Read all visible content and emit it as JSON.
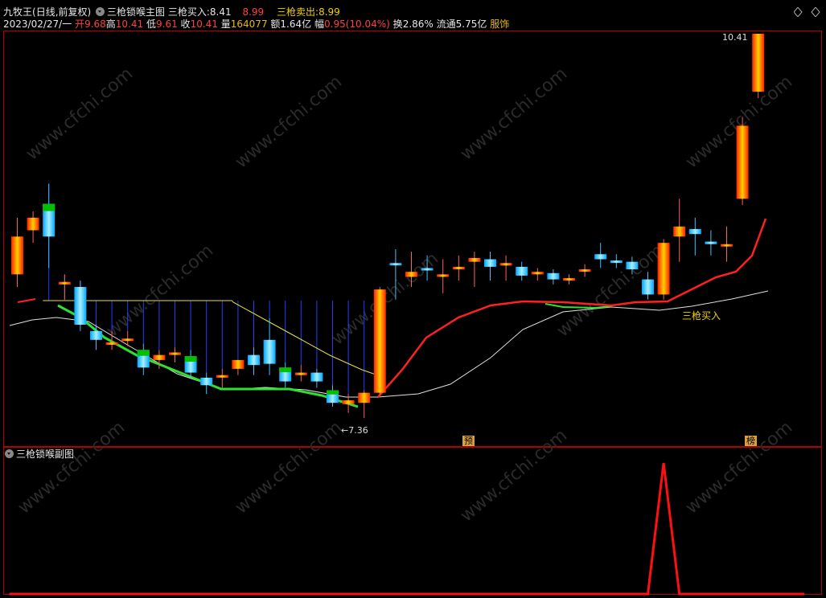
{
  "main_title": {
    "app": "九牧王",
    "period": "(日线,前复权)",
    "indicator": "三枪锁喉主图",
    "buy_label": "三枪买入:",
    "buy_value": "8.41",
    "buy_value2": "8.99",
    "sell_label": "三枪卖出:",
    "sell_value": "8.99"
  },
  "quote": {
    "date": "2023/02/27/一",
    "open_label": "开",
    "open": "9.68",
    "high_label": "高",
    "high": "10.41",
    "low_label": "低",
    "low": "9.61",
    "close_label": "收",
    "close": "10.41",
    "vol_label": "量",
    "vol": "164077",
    "amount_label": "额",
    "amount": "1.64亿",
    "change_label": "幅",
    "change": "0.95(10.04%)",
    "turnover_label": "换",
    "turnover": "2.86%",
    "float_label": "流通",
    "float": "5.75亿",
    "sector": "服饰"
  },
  "annotations": {
    "high_mark": "10.41",
    "low_mark": "←7.36",
    "buy_signal": "三枪买入",
    "tag_yu": "预",
    "tag_bang": "榜"
  },
  "sub_title": "三枪锁喉副图",
  "watermark": "www.cfchi.com",
  "colors": {
    "frame": "#b00000",
    "bull_red": "#ff2000",
    "bull_yellow": "#ffd000",
    "bear_cyan": "#00a8ff",
    "bear_green": "#00c000",
    "ma_green": "#30e030",
    "ma_red": "#ff2020",
    "line_white": "#e0e0e0",
    "line_yellow": "#e8e040",
    "sub_line": "#ff1010"
  },
  "chart_data": {
    "type": "candlestick",
    "price_range": [
      7.36,
      10.41
    ],
    "candles": [
      {
        "o": 8.8,
        "c": 8.5,
        "h": 8.95,
        "l": 8.4,
        "dir": "up"
      },
      {
        "o": 8.85,
        "c": 8.95,
        "h": 9.0,
        "l": 8.75,
        "dir": "up"
      },
      {
        "o": 8.8,
        "c": 9.06,
        "h": 9.22,
        "l": 8.55,
        "dir": "down"
      },
      {
        "o": 8.42,
        "c": 8.44,
        "h": 8.5,
        "l": 8.3,
        "dir": "up"
      },
      {
        "o": 8.4,
        "c": 8.1,
        "h": 8.45,
        "l": 8.05,
        "dir": "down"
      },
      {
        "o": 8.05,
        "c": 7.98,
        "h": 8.1,
        "l": 7.9,
        "dir": "down"
      },
      {
        "o": 7.95,
        "c": 7.96,
        "h": 8.05,
        "l": 7.9,
        "dir": "up"
      },
      {
        "o": 7.98,
        "c": 7.99,
        "h": 8.05,
        "l": 7.93,
        "dir": "up"
      },
      {
        "o": 7.9,
        "c": 7.76,
        "h": 7.95,
        "l": 7.7,
        "dir": "down"
      },
      {
        "o": 7.82,
        "c": 7.86,
        "h": 7.9,
        "l": 7.75,
        "dir": "up"
      },
      {
        "o": 7.86,
        "c": 7.88,
        "h": 7.92,
        "l": 7.8,
        "dir": "up"
      },
      {
        "o": 7.85,
        "c": 7.72,
        "h": 7.9,
        "l": 7.68,
        "dir": "down"
      },
      {
        "o": 7.68,
        "c": 7.62,
        "h": 7.72,
        "l": 7.55,
        "dir": "down"
      },
      {
        "o": 7.68,
        "c": 7.7,
        "h": 7.75,
        "l": 7.6,
        "dir": "up"
      },
      {
        "o": 7.75,
        "c": 7.82,
        "h": 7.8,
        "l": 7.7,
        "dir": "up"
      },
      {
        "o": 7.78,
        "c": 7.86,
        "h": 7.92,
        "l": 7.7,
        "dir": "down"
      },
      {
        "o": 7.79,
        "c": 7.98,
        "h": 8.15,
        "l": 7.7,
        "dir": "down"
      },
      {
        "o": 7.76,
        "c": 7.65,
        "h": 7.8,
        "l": 7.6,
        "dir": "down"
      },
      {
        "o": 7.72,
        "c": 7.7,
        "h": 7.78,
        "l": 7.65,
        "dir": "up"
      },
      {
        "o": 7.72,
        "c": 7.65,
        "h": 7.75,
        "l": 7.6,
        "dir": "down"
      },
      {
        "o": 7.58,
        "c": 7.48,
        "h": 7.62,
        "l": 7.45,
        "dir": "down"
      },
      {
        "o": 7.5,
        "c": 7.47,
        "h": 7.55,
        "l": 7.4,
        "dir": "up"
      },
      {
        "o": 7.48,
        "c": 7.56,
        "h": 7.58,
        "l": 7.36,
        "dir": "up"
      },
      {
        "o": 7.56,
        "c": 8.38,
        "h": 8.4,
        "l": 7.54,
        "dir": "up"
      },
      {
        "o": 8.59,
        "c": 8.58,
        "h": 8.7,
        "l": 8.3,
        "dir": "down"
      },
      {
        "o": 8.52,
        "c": 8.48,
        "h": 8.68,
        "l": 8.4,
        "dir": "up"
      },
      {
        "o": 8.55,
        "c": 8.54,
        "h": 8.65,
        "l": 8.45,
        "dir": "down"
      },
      {
        "o": 8.5,
        "c": 8.48,
        "h": 8.62,
        "l": 8.35,
        "dir": "up"
      },
      {
        "o": 8.56,
        "c": 8.54,
        "h": 8.65,
        "l": 8.45,
        "dir": "up"
      },
      {
        "o": 8.63,
        "c": 8.6,
        "h": 8.68,
        "l": 8.4,
        "dir": "up"
      },
      {
        "o": 8.62,
        "c": 8.56,
        "h": 8.68,
        "l": 8.45,
        "dir": "down"
      },
      {
        "o": 8.59,
        "c": 8.57,
        "h": 8.65,
        "l": 8.45,
        "dir": "up"
      },
      {
        "o": 8.56,
        "c": 8.49,
        "h": 8.6,
        "l": 8.45,
        "dir": "down"
      },
      {
        "o": 8.52,
        "c": 8.5,
        "h": 8.55,
        "l": 8.45,
        "dir": "up"
      },
      {
        "o": 8.51,
        "c": 8.46,
        "h": 8.54,
        "l": 8.42,
        "dir": "down"
      },
      {
        "o": 8.47,
        "c": 8.46,
        "h": 8.5,
        "l": 8.42,
        "dir": "up"
      },
      {
        "o": 8.54,
        "c": 8.53,
        "h": 8.58,
        "l": 8.48,
        "dir": "up"
      },
      {
        "o": 8.66,
        "c": 8.62,
        "h": 8.75,
        "l": 8.55,
        "dir": "down"
      },
      {
        "o": 8.61,
        "c": 8.6,
        "h": 8.66,
        "l": 8.55,
        "dir": "down"
      },
      {
        "o": 8.6,
        "c": 8.54,
        "h": 8.64,
        "l": 8.5,
        "dir": "down"
      },
      {
        "o": 8.46,
        "c": 8.34,
        "h": 8.52,
        "l": 8.3,
        "dir": "down"
      },
      {
        "o": 8.34,
        "c": 8.75,
        "h": 8.78,
        "l": 8.3,
        "dir": "up"
      },
      {
        "o": 8.88,
        "c": 8.8,
        "h": 9.1,
        "l": 8.6,
        "dir": "up"
      },
      {
        "o": 8.86,
        "c": 8.82,
        "h": 8.95,
        "l": 8.65,
        "dir": "down"
      },
      {
        "o": 8.76,
        "c": 8.74,
        "h": 8.85,
        "l": 8.65,
        "dir": "down"
      },
      {
        "o": 8.74,
        "c": 8.73,
        "h": 8.88,
        "l": 8.6,
        "dir": "up"
      },
      {
        "o": 9.1,
        "c": 9.68,
        "h": 9.75,
        "l": 9.05,
        "dir": "up"
      },
      {
        "o": 9.95,
        "c": 10.41,
        "h": 10.41,
        "l": 9.9,
        "dir": "up"
      }
    ],
    "sub_signal": {
      "type": "line",
      "values": [
        0,
        0,
        0,
        0,
        0,
        0,
        0,
        0,
        0,
        0,
        0,
        0,
        0,
        0,
        0,
        0,
        0,
        0,
        0,
        0,
        0,
        0,
        0,
        0,
        0,
        0,
        0,
        0,
        0,
        0,
        0,
        0,
        0,
        0,
        0,
        0,
        0,
        0,
        0,
        0,
        0,
        1,
        0,
        0,
        0,
        0,
        0,
        0
      ],
      "ylim": [
        0,
        1
      ]
    }
  }
}
